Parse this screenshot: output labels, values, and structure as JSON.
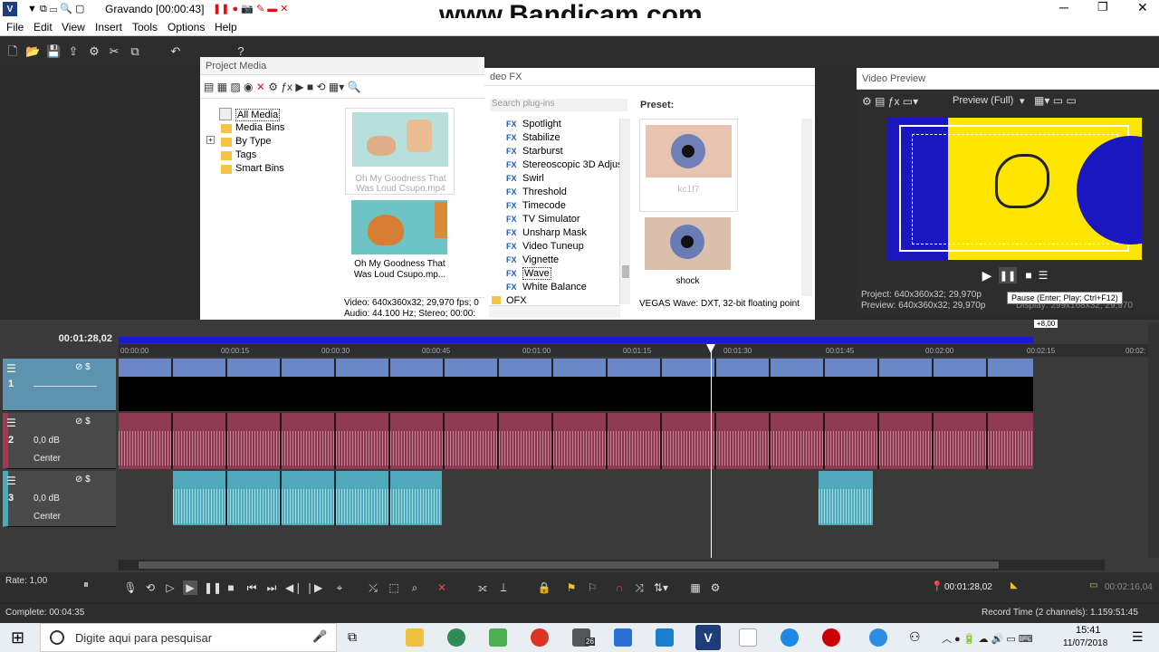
{
  "titlebar": {
    "title": "Gravando [00:00:43]",
    "watermark": "www.Bandicam.com"
  },
  "menu": [
    "File",
    "Edit",
    "View",
    "Insert",
    "Tools",
    "Options",
    "Help"
  ],
  "project_media": {
    "title": "Project Media",
    "tree": [
      "All Media",
      "Media Bins",
      "By Type",
      "Tags",
      "Smart Bins"
    ],
    "thumb1": "Oh My Goodness That Was Loud Csupo.mp4",
    "thumb2": "Oh My Goodness That Was Loud Csupo.mp...",
    "info_video": "Video: 640x360x32; 29,970 fps; 0",
    "info_audio": "Audio: 44.100 Hz; Stereo; 00:00:"
  },
  "video_fx": {
    "title": "deo FX",
    "search_placeholder": "Search plug-ins",
    "preset_label": "Preset:",
    "items": [
      "Spotlight",
      "Stabilize",
      "Starburst",
      "Stereoscopic 3D Adjust",
      "Swirl",
      "Threshold",
      "Timecode",
      "TV Simulator",
      "Unsharp Mask",
      "Video Tuneup",
      "Vignette",
      "Wave",
      "White Balance"
    ],
    "folder": "OFX",
    "preset1": "kc1f7",
    "preset2": "shock",
    "status": "VEGAS Wave: DXT, 32-bit floating point"
  },
  "video_preview": {
    "title": "Video Preview",
    "mode": "Preview (Full)",
    "project": "Project:  640x360x32; 29,970p",
    "preview": "Preview: 640x360x32; 29,970p",
    "display": "Display:  299x168x32; 29,970",
    "tooltip": "Pause (Enter; Play; Ctrl+F12)"
  },
  "timeline": {
    "cursor_time": "00:01:28,02",
    "ruler": [
      "00:00:00",
      "00:00:15",
      "00:00:30",
      "00:00:45",
      "00:01:00",
      "00:01:15",
      "00:01:30",
      "00:01:45",
      "00:02:00",
      "00:02:15",
      "00:02:"
    ],
    "region_end": "+8,00",
    "tracks": [
      {
        "num": "1",
        "type": "video"
      },
      {
        "num": "2",
        "type": "audio",
        "vol": "0,0 dB",
        "pan": "Center"
      },
      {
        "num": "3",
        "type": "audio",
        "vol": "0,0 dB",
        "pan": "Center"
      }
    ],
    "rate": "Rate: 1,00",
    "position": "00:01:28,02",
    "length": "00:02:16,04"
  },
  "status": {
    "complete": "Complete: 00:04:35",
    "record": "Record Time (2 channels): 1.159:51:45"
  },
  "taskbar": {
    "search": "Digite aqui para pesquisar",
    "time": "15:41",
    "date": "11/07/2018",
    "badge": "26"
  },
  "colors": {
    "video_clip": "#6a86c4",
    "audio2": "#8e3a52",
    "audio3": "#4fa9bb",
    "preview_yellow": "#ffe600",
    "preview_blue": "#1a16c0"
  }
}
